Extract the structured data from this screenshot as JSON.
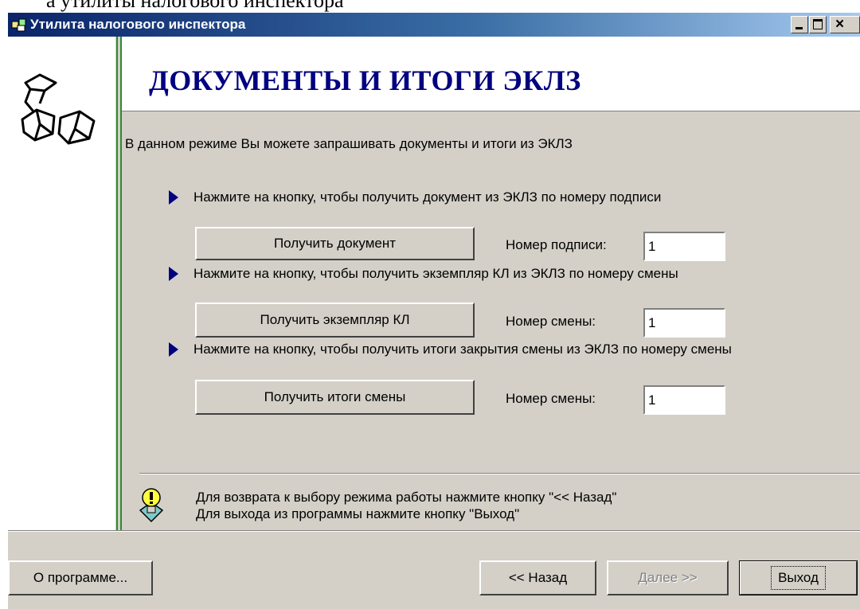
{
  "document": {
    "above_text": "а утилиты налогового инспектора"
  },
  "window": {
    "title": "Утилита налогового инспектора",
    "title_icon": "app-icon"
  },
  "header": {
    "title": "ДОКУМЕНТЫ И ИТОГИ ЭКЛЗ"
  },
  "intro": "В данном режиме Вы можете запрашивать документы и итоги из ЭКЛЗ",
  "sections": [
    {
      "instruction": "Нажмите на кнопку, чтобы получить документ из  ЭКЛЗ по номеру подписи",
      "button_label": "Получить документ",
      "field_label": "Номер подписи:",
      "field_value": "1"
    },
    {
      "instruction": "Нажмите на кнопку, чтобы получить экземпляр КЛ из ЭКЛЗ по номеру смены",
      "button_label": "Получить экземпляр КЛ",
      "field_label": "Номер смены:",
      "field_value": "1"
    },
    {
      "instruction": "Нажмите на кнопку, чтобы получить итоги закрытия смены из ЭКЛЗ по номеру смены",
      "button_label": "Получить итоги смены",
      "field_label": "Номер смены:",
      "field_value": "1"
    }
  ],
  "tip": {
    "line1": "Для возврата к выбору режима работы нажмите кнопку \"<< Назад\"",
    "line2": "Для выхода из программы нажмите кнопку \"Выход\""
  },
  "footer": {
    "about_label": "О программе...",
    "back_label": "<< Назад",
    "next_label": "Далее >>",
    "exit_label": "Выход"
  },
  "colors": {
    "title_accent": "#000080",
    "dialog_bg": "#d4d0c8",
    "sidebar_line": "#2f8a2f"
  }
}
